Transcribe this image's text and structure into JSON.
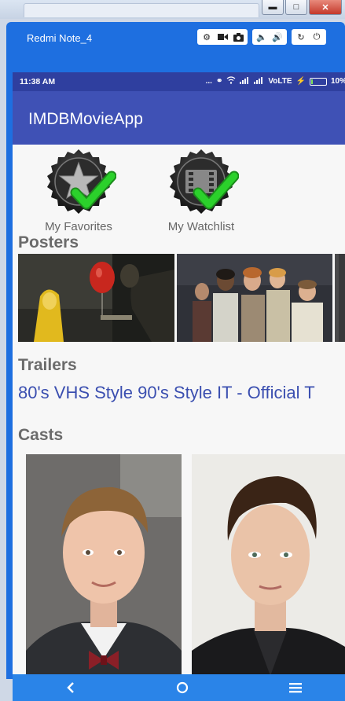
{
  "emulator": {
    "device_name": "Redmi Note_4"
  },
  "status_bar": {
    "time": "11:38 AM",
    "dots": "...",
    "carrier": "VoLTE",
    "battery_percent_text": "10%",
    "battery_level": 0.1
  },
  "app": {
    "title": "IMDBMovieApp"
  },
  "shortcuts": [
    {
      "label": "My Favorites",
      "icon": "star-badge-check-icon"
    },
    {
      "label": "My Watchlist",
      "icon": "film-badge-check-icon"
    }
  ],
  "sections": {
    "posters": "Posters",
    "trailers": "Trailers",
    "casts": "Casts"
  },
  "trailer": {
    "title": "80's VHS Style 90's Style IT - Official T"
  },
  "colors": {
    "app_bar": "#3f51b5",
    "status_bar": "#2f3f9f",
    "emulator_frame": "#1e6fe0",
    "link": "#3b4fb0",
    "check": "#2bd12b"
  }
}
